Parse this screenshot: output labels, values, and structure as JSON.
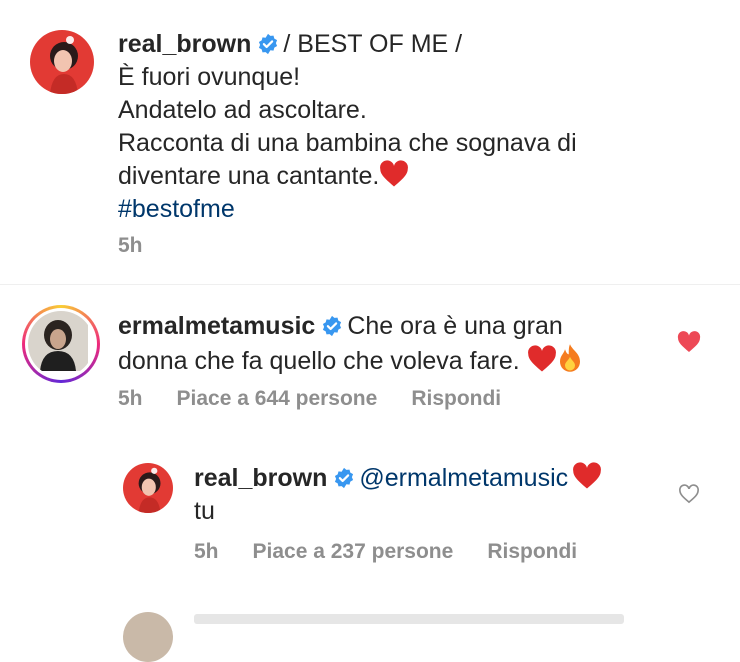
{
  "post": {
    "username": "real_brown",
    "text_head": "/ BEST OF ME /",
    "lines": [
      "È fuori ovunque!",
      "Andatelo ad ascoltare.",
      "Racconta di una bambina che sognava di",
      "diventare una cantante."
    ],
    "hashtag": "#bestofme",
    "time": "5h"
  },
  "comment": {
    "username": "ermalmetamusic",
    "text_1": "Che ora è una gran",
    "text_2": "donna che fa quello che voleva fare.",
    "time": "5h",
    "likes": "Piace a 644 persone",
    "reply_label": "Rispondi",
    "liked": true
  },
  "reply": {
    "username": "real_brown",
    "mention": "@ermalmetamusic",
    "text": "tu",
    "time": "5h",
    "likes": "Piace a 237 persone",
    "reply_label": "Rispondi",
    "liked": false
  },
  "colors": {
    "heart_red": "#ed4956",
    "link_blue": "#00376b",
    "verified_blue": "#3897f0",
    "muted": "#8e8e8e"
  }
}
